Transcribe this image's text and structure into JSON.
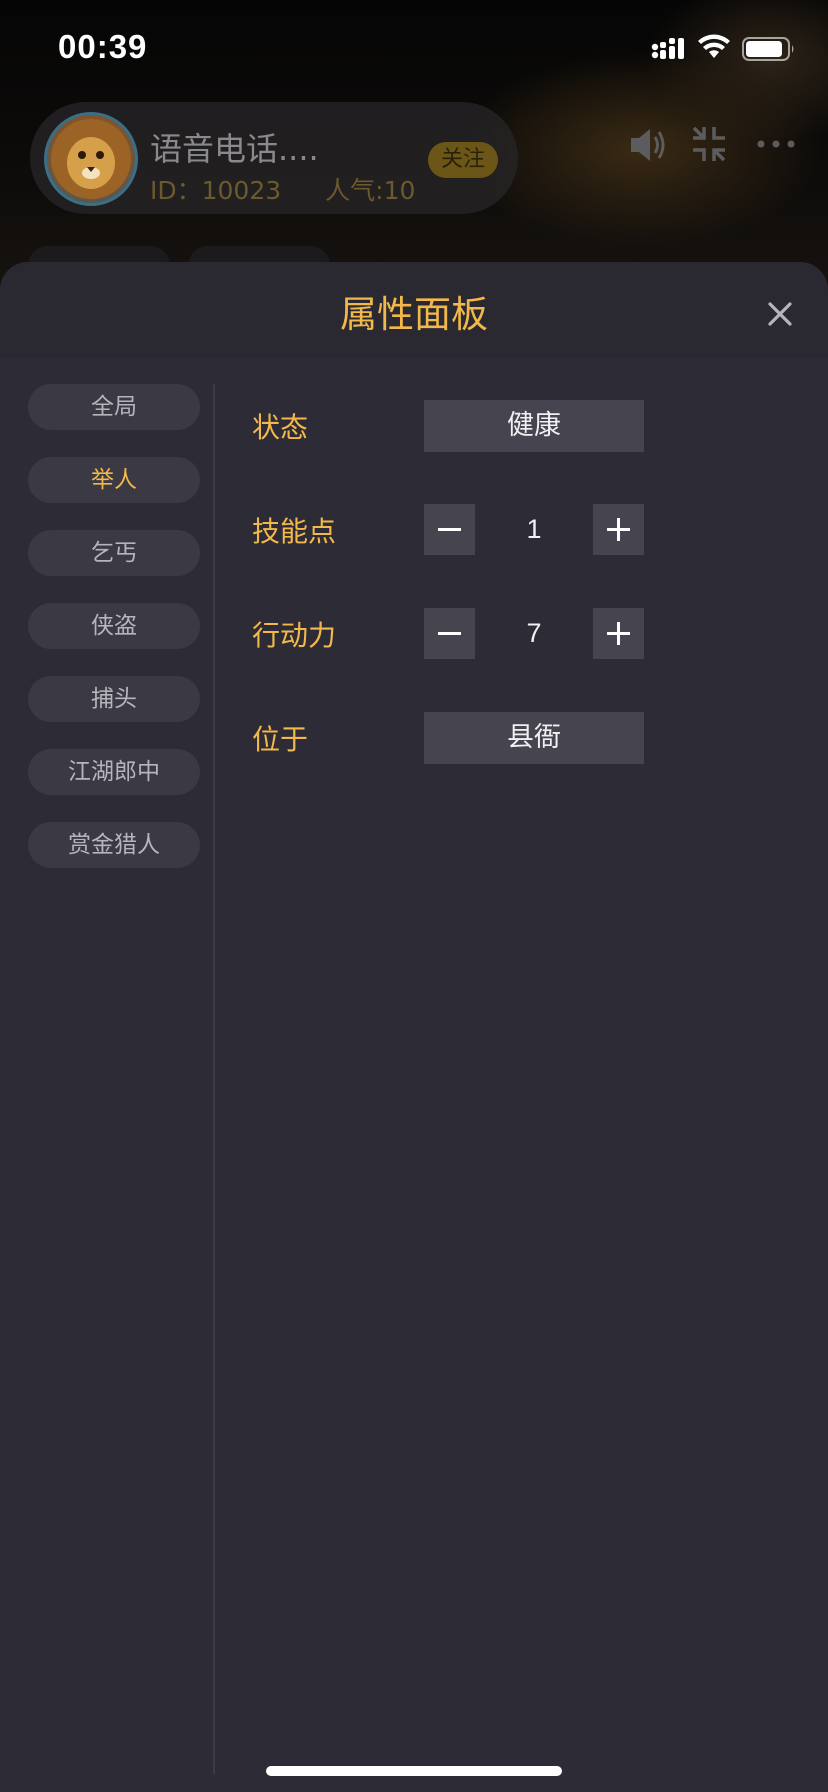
{
  "status_bar": {
    "time": "00:39",
    "icons": [
      "cellular-signal-icon",
      "wifi-icon",
      "battery-icon"
    ]
  },
  "room": {
    "title": "语音电话....",
    "id_label": "ID：10023",
    "popularity": "人气:10",
    "follow_label": "关注",
    "actions": [
      "speaker-icon",
      "minimize-icon",
      "more-icon"
    ]
  },
  "panel": {
    "title": "属性面板",
    "close_icon": "close-icon",
    "categories": [
      {
        "label": "全局",
        "active": false
      },
      {
        "label": "举人",
        "active": true
      },
      {
        "label": "乞丐",
        "active": false
      },
      {
        "label": "侠盗",
        "active": false
      },
      {
        "label": "捕头",
        "active": false
      },
      {
        "label": "江湖郎中",
        "active": false
      },
      {
        "label": "赏金猎人",
        "active": false
      }
    ],
    "attributes": {
      "status": {
        "label": "状态",
        "value": "健康"
      },
      "skill_points": {
        "label": "技能点",
        "value": "1"
      },
      "action_points": {
        "label": "行动力",
        "value": "7"
      },
      "location": {
        "label": "位于",
        "value": "县衙"
      }
    }
  },
  "colors": {
    "accent": "#f2b84a",
    "sheet_bg": "#2d2c36",
    "control_bg": "#45444f",
    "pill_bg": "#3a3944"
  }
}
